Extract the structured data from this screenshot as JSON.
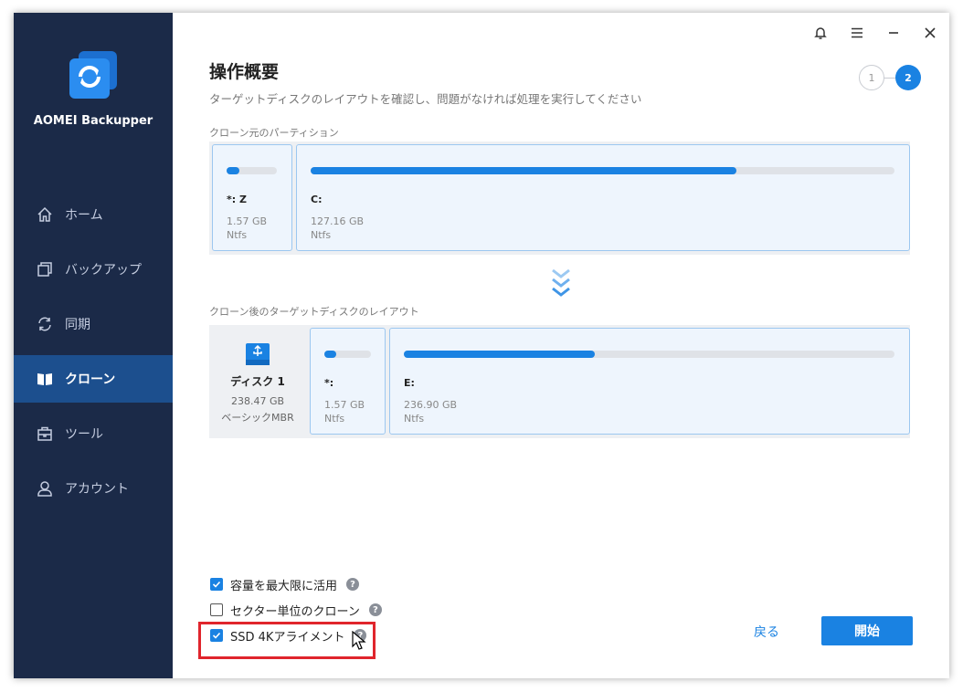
{
  "app": {
    "brand": "AOMEI Backupper"
  },
  "sidebar": {
    "items": [
      {
        "label": "ホーム",
        "icon": "home-icon",
        "active": false
      },
      {
        "label": "バックアップ",
        "icon": "backup-icon",
        "active": false
      },
      {
        "label": "同期",
        "icon": "sync-icon",
        "active": false
      },
      {
        "label": "クローン",
        "icon": "clone-icon",
        "active": true
      },
      {
        "label": "ツール",
        "icon": "tools-icon",
        "active": false
      },
      {
        "label": "アカウント",
        "icon": "account-icon",
        "active": false
      }
    ]
  },
  "titlebar": {
    "icons": [
      "bell-icon",
      "menu-icon",
      "minimize-icon",
      "close-icon"
    ]
  },
  "header": {
    "title": "操作概要",
    "subtitle": "ターゲットディスクのレイアウトを確認し、問題がなければ処理を実行してください",
    "steps": [
      "1",
      "2"
    ],
    "current_step": 2
  },
  "source": {
    "label": "クローン元のパーティション",
    "partitions": [
      {
        "name": "*: Z",
        "size": "1.57 GB",
        "fs": "Ntfs",
        "usage": 0.25
      },
      {
        "name": "C:",
        "size": "127.16 GB",
        "fs": "Ntfs",
        "usage": 0.73
      }
    ]
  },
  "target": {
    "label": "クローン後のターゲットディスクのレイアウト",
    "disk": {
      "name": "ディスク 1",
      "size": "238.47 GB",
      "type": "ベーシックMBR",
      "icon": "usb-disk-icon"
    },
    "partitions": [
      {
        "name": "*:",
        "size": "1.57 GB",
        "fs": "Ntfs",
        "usage": 0.25
      },
      {
        "name": "E:",
        "size": "236.90 GB",
        "fs": "Ntfs",
        "usage": 0.39
      }
    ]
  },
  "options": [
    {
      "label": "容量を最大限に活用",
      "checked": true
    },
    {
      "label": "セクター単位のクローン",
      "checked": false
    },
    {
      "label": "SSD 4Kアライメント",
      "checked": true
    }
  ],
  "help_glyph": "?",
  "buttons": {
    "back": "戻る",
    "start": "開始"
  },
  "colors": {
    "sidebar_bg": "#1b2a48",
    "sidebar_active": "#1c4f8e",
    "accent": "#1a82e2",
    "highlight": "#e0252c"
  }
}
